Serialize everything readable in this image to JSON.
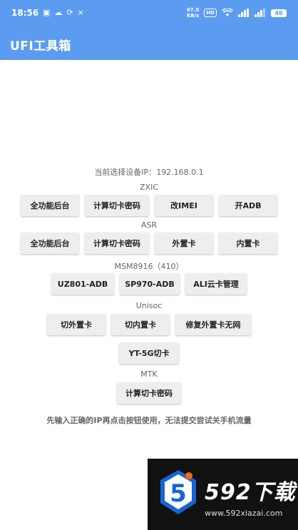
{
  "status_bar": {
    "time": "18:56",
    "speed_top": "67.0",
    "speed_bottom": "KB/s",
    "hd_label": "HD",
    "battery": "46"
  },
  "app_bar": {
    "title": "UFI工具箱"
  },
  "ip_label": "当前选择设备IP：192.168.0.1",
  "sections": {
    "zxic": {
      "heading": "ZXIC",
      "buttons": [
        "全功能后台",
        "计算切卡密码",
        "改IMEI",
        "开ADB"
      ]
    },
    "asr": {
      "heading": "ASR",
      "buttons": [
        "全功能后台",
        "计算切卡密码",
        "外置卡",
        "内置卡"
      ]
    },
    "msm": {
      "heading": "MSM8916（410）",
      "buttons": [
        "UZ801-ADB",
        "SP970-ADB",
        "ALI云卡管理"
      ]
    },
    "unisoc": {
      "heading": "Unisoc",
      "buttons": [
        "切外置卡",
        "切内置卡",
        "修复外置卡无网",
        "YT-5G切卡"
      ]
    },
    "mtk": {
      "heading": "MTK",
      "buttons": [
        "计算切卡密码"
      ]
    }
  },
  "footer_note": "先输入正确的IP再点击按钮使用，无法提交尝试关手机流量",
  "watermark": {
    "brand": "592下载",
    "url": "www.592xiazai.com",
    "logo_digit": "5"
  },
  "colors": {
    "accent": "#5b9cf0",
    "button_bg": "#eeeeee"
  }
}
